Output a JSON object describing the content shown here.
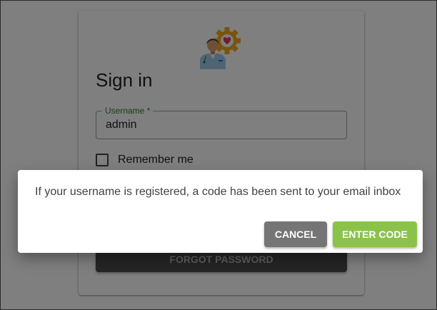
{
  "login": {
    "title": "Sign in",
    "username_label": "Username *",
    "username_value": "admin",
    "remember_label": "Remember me",
    "forgot_label": "FORGOT PASSWORD"
  },
  "dialog": {
    "message": "If your username is registered, a code has been sent to your email inbox",
    "cancel_label": "CANCEL",
    "enter_code_label": "ENTER CODE"
  },
  "icons": {
    "logo": "doctor-gear-heart-icon",
    "checkbox": "checkbox-unchecked-icon"
  },
  "colors": {
    "label_accent": "#2e7d32",
    "enter_code_button": "#8bc34a",
    "cancel_button": "#757575",
    "forgot_button": "#4a4a4a"
  }
}
